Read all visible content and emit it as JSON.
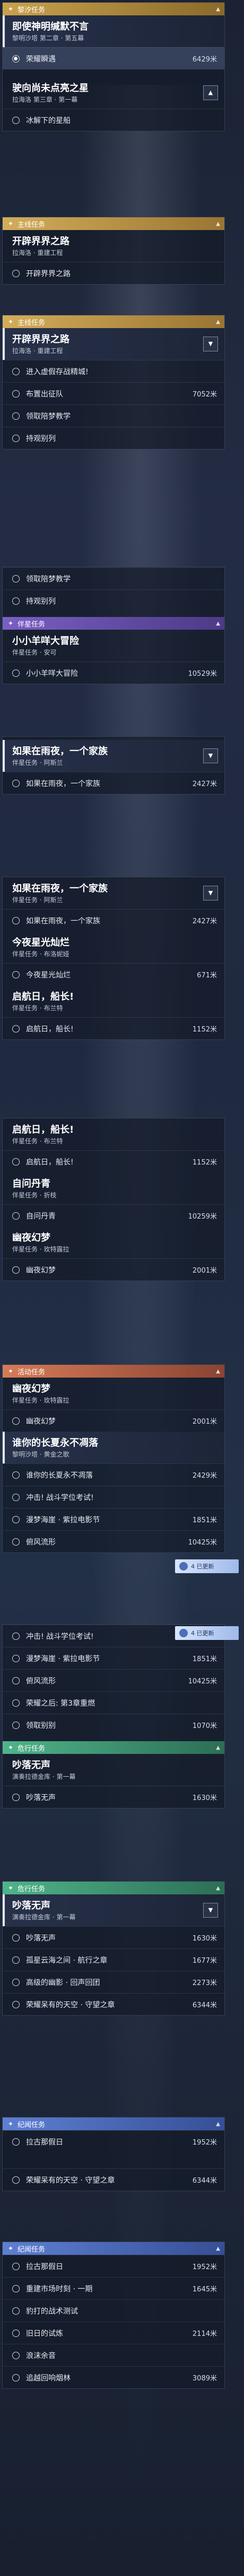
{
  "screens": [
    {
      "category": "黎汐任务",
      "category_color": "#c9a24c",
      "quests": [
        {
          "title": "即使神明缄默不言",
          "subtitle": "黎明沙塔 第二章 · 第五幕",
          "active": true,
          "steps": [
            {
              "text": "荣耀瞬遇",
              "dist": "6429米",
              "current": true
            }
          ]
        },
        {
          "title": "驶向尚未点亮之星",
          "subtitle": "拉海洛 第三章 · 第一幕",
          "active": false,
          "steps": [
            {
              "text": "冰解下的星船",
              "dist": ""
            }
          ]
        }
      ]
    },
    {
      "category": "主线任务",
      "quests": [
        {
          "title": "开辟界界之路",
          "subtitle": "拉海洛 · 重建工程",
          "active": false,
          "steps": [
            {
              "text": "开辟界界之路",
              "dist": ""
            }
          ]
        }
      ]
    },
    {
      "category": "主线任务",
      "quests": [
        {
          "title": "开辟界界之路",
          "subtitle": "拉海洛 · 重建工程",
          "active": true,
          "steps": [
            {
              "text": "进入虚假存战精城!",
              "dist": ""
            },
            {
              "text": "布置出征队",
              "dist": "7052米"
            },
            {
              "text": "领取陪梦教学",
              "dist": ""
            },
            {
              "text": "持观别列",
              "dist": ""
            }
          ]
        }
      ]
    },
    {
      "category": "伴星任务",
      "quests": [
        {
          "title": "小小羊咩大冒险",
          "subtitle": "伴星任务 · 安可",
          "active": false,
          "steps": [
            {
              "text": "小小羊咩大冒险",
              "dist": "10529米"
            }
          ]
        }
      ],
      "pre_steps": [
        {
          "text": "领取陪梦教学",
          "dist": ""
        },
        {
          "text": "持观别列",
          "dist": ""
        }
      ]
    },
    {
      "category": "伴星任务",
      "quests": [
        {
          "title": "如果在雨夜，一个家族",
          "subtitle": "伴星任务 · 阿斯兰",
          "active": true,
          "steps": [
            {
              "text": "如果在雨夜，一个家族",
              "dist": "2427米"
            }
          ]
        }
      ]
    },
    {
      "category": "伴星任务",
      "quests": [
        {
          "title": "如果在雨夜，一个家族",
          "subtitle": "伴星任务 · 阿斯兰",
          "active": false,
          "steps": [
            {
              "text": "如果在雨夜，一个家族",
              "dist": "2427米"
            }
          ]
        },
        {
          "title": "今夜星光灿烂",
          "subtitle": "伴星任务 · 布洛妮娅",
          "active": false,
          "steps": [
            {
              "text": "今夜星光灿烂",
              "dist": "671米"
            }
          ]
        },
        {
          "title": "启航日，船长!",
          "subtitle": "伴星任务 · 布兰特",
          "active": false,
          "steps": [
            {
              "text": "启航日，船长!",
              "dist": "1152米"
            }
          ]
        }
      ]
    },
    {
      "category": "伴星任务",
      "quests": [
        {
          "title": "启航日，船长!",
          "subtitle": "伴星任务 · 布兰特",
          "active": false,
          "steps": [
            {
              "text": "启航日，船长!",
              "dist": "1152米"
            }
          ]
        },
        {
          "title": "自问丹青",
          "subtitle": "伴星任务 · 折枝",
          "active": false,
          "steps": [
            {
              "text": "自问丹青",
              "dist": "10259米"
            }
          ]
        },
        {
          "title": "幽夜幻梦",
          "subtitle": "伴星任务 · 玫特露拉",
          "active": false,
          "steps": [
            {
              "text": "幽夜幻梦",
              "dist": "2001米"
            }
          ]
        }
      ]
    },
    {
      "category": "活动任务",
      "quests": [
        {
          "title": "幽夜幻梦",
          "subtitle": "伴星任务 · 玫特露拉",
          "active": false,
          "steps": [
            {
              "text": "幽夜幻梦",
              "dist": "2001米"
            }
          ]
        },
        {
          "title": "谁你的长夏永不凋落",
          "subtitle": "黎明沙塔 · 黄金之歌",
          "active": true,
          "steps": [
            {
              "text": "谁你的长夏永不凋落",
              "dist": "2429米"
            },
            {
              "text": "冲击! 战斗学位考试!",
              "dist": ""
            },
            {
              "text": "漫梦海崖 · 紫拉电影节",
              "dist": "1851米"
            },
            {
              "text": "俯风流形",
              "dist": "10425米"
            }
          ]
        }
      ],
      "banner": "4 已更新"
    },
    {
      "category": "危行任务",
      "quests": [
        {
          "title": "吵落无声",
          "subtitle": "演奏拉德金库 · 第一幕",
          "active": false,
          "steps": [
            {
              "text": "吵落无声",
              "dist": "1630米"
            }
          ]
        }
      ],
      "pre_steps": [
        {
          "text": "冲击! 战斗学位考试!",
          "dist": ""
        },
        {
          "text": "漫梦海崖 · 紫拉电影节",
          "dist": "1851米"
        },
        {
          "text": "俯风流形",
          "dist": "10425米"
        },
        {
          "text": "荣耀之后: 第3章重燃",
          "dist": ""
        },
        {
          "text": "领取别别",
          "dist": "1070米"
        }
      ],
      "banner": "4 已更新"
    },
    {
      "category": "危行任务",
      "quests": [
        {
          "title": "吵落无声",
          "subtitle": "演奏拉德金库 · 第一幕",
          "active": true,
          "steps": [
            {
              "text": "吵落无声",
              "dist": "1630米"
            },
            {
              "text": "孤星云海之间 · 航行之章",
              "dist": "1677米"
            },
            {
              "text": "高级的幽影 · 回声回团",
              "dist": "2273米"
            },
            {
              "text": "荣耀呆有的天空 · 守望之章",
              "dist": "6344米"
            }
          ]
        }
      ]
    },
    {
      "category": "纪闻任务",
      "quests": [
        {
          "title": "拉古那假日",
          "subtitle": "",
          "active": false,
          "steps": [
            {
              "text": "拉古那假日",
              "dist": "1952米"
            },
            {
              "text": "荣耀呆有的天空 · 守望之章",
              "dist": "6344米"
            }
          ]
        }
      ]
    },
    {
      "category": "纪闻任务",
      "quests": [
        {
          "title": "",
          "subtitle": "",
          "active": false,
          "steps": [
            {
              "text": "拉古那假日",
              "dist": "1952米"
            },
            {
              "text": "重建市场时刻 · 一期",
              "dist": "1645米"
            },
            {
              "text": "豹打的战术测试",
              "dist": ""
            },
            {
              "text": "旧日的试炼",
              "dist": "2114米"
            },
            {
              "text": "浪沫余音",
              "dist": ""
            },
            {
              "text": "追越回响烟林",
              "dist": "3089米"
            }
          ]
        }
      ]
    }
  ]
}
